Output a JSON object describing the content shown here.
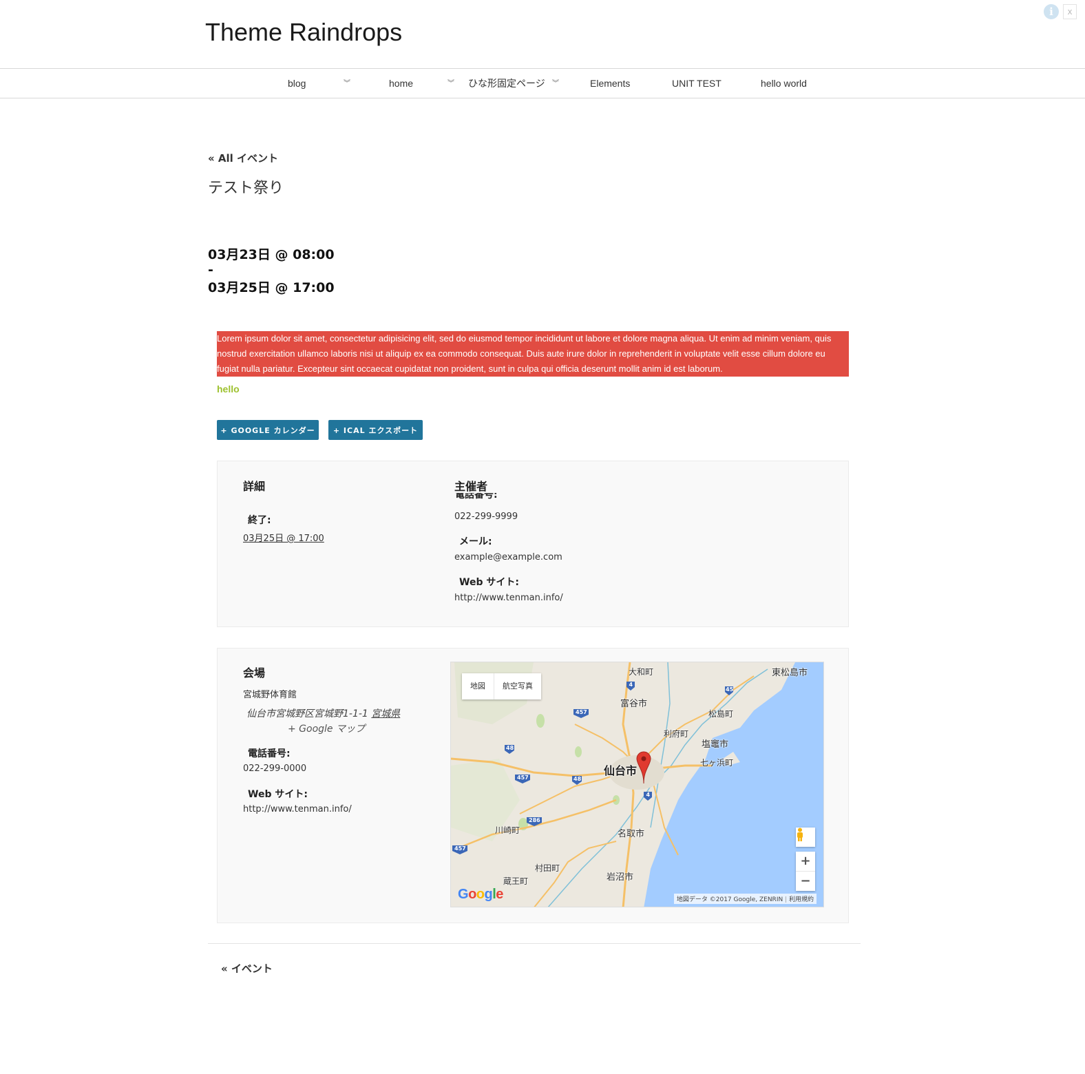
{
  "site": {
    "title": "Theme Raindrops"
  },
  "corner": {
    "info_icon": "info-icon",
    "close_label": "x"
  },
  "nav": {
    "items": [
      {
        "label": "blog"
      },
      {
        "label": "home"
      },
      {
        "label": "ひな形固定ページ"
      },
      {
        "label": "Elements"
      },
      {
        "label": "UNIT TEST"
      },
      {
        "label": "hello world"
      }
    ],
    "dropdown_icon": "double-chevron-down-icon",
    "arrow_glyph": "»"
  },
  "event": {
    "back_label": "« All イベント",
    "title": "テスト祭り",
    "start": "03月23日 @ 08:00",
    "separator": "-",
    "end": "03月25日 @ 17:00",
    "description": "Lorem ipsum dolor sit amet, consectetur adipisicing elit, sed do eiusmod tempor incididunt ut labore et dolore magna aliqua. Ut enim ad minim veniam, quis nostrud exercitation ullamco laboris nisi ut aliquip ex ea commodo consequat. Duis aute irure dolor in reprehenderit in voluptate velit esse cillum dolore eu fugiat nulla pariatur. Excepteur sint occaecat cupidatat non proident, sunt in culpa qui officia deserunt mollit anim id est laborum.",
    "hello": "hello",
    "colors": {
      "description_bg": "#e14c42",
      "hello": "#9dc12e",
      "button_bg": "#21759b"
    }
  },
  "buttons": {
    "google": "+ GOOGLE カレンダー",
    "ical": "+ ICAL エクスポート"
  },
  "details": {
    "heading": "詳細",
    "end_label": "終了:",
    "end_value": "03月25日 @ 17:00"
  },
  "organizer": {
    "heading": "主催者",
    "clipped_label": "電話番号:",
    "phone": "022-299-9999",
    "email_label": "メール:",
    "email": "example@example.com",
    "website_label": "Web サイト:",
    "website": "http://www.tenman.info/"
  },
  "venue": {
    "heading": "会場",
    "name": "宮城野体育館",
    "address": "仙台市宮城野区宮城野1-1-1",
    "region": "宮城県",
    "gmap_link": "+ Google マップ",
    "phone_label": "電話番号:",
    "phone": "022-299-0000",
    "website_label": "Web サイト:",
    "website": "http://www.tenman.info/"
  },
  "map": {
    "type_map": "地図",
    "type_satellite": "航空写真",
    "zoom_in": "+",
    "zoom_out": "−",
    "attribution": "地図データ ©2017 Google, ZENRIN",
    "terms": "利用規約",
    "logo": "Google",
    "pegman_icon": "pegman-icon",
    "marker_icon": "map-marker-icon",
    "places": {
      "higashimatsushima": "東松島市",
      "taiwa": "大和町",
      "tomiya": "富谷市",
      "matsushima": "松島町",
      "rifu": "利府町",
      "shiogama": "塩竈市",
      "shichigahama": "七ヶ浜町",
      "sendai": "仙台市",
      "kawasaki": "川崎町",
      "natori": "名取市",
      "murata": "村田町",
      "zao": "蔵王町",
      "iwanuma": "岩沼市"
    },
    "shields": {
      "r4": "4",
      "r45": "45",
      "r457": "457",
      "r48": "48",
      "r286": "286"
    },
    "colors": {
      "sea": "#a3ccff",
      "land": "#ece8df",
      "road": "#f5c067",
      "marker": "#e03a2f"
    }
  },
  "footer": {
    "back_label": "« イベント"
  }
}
